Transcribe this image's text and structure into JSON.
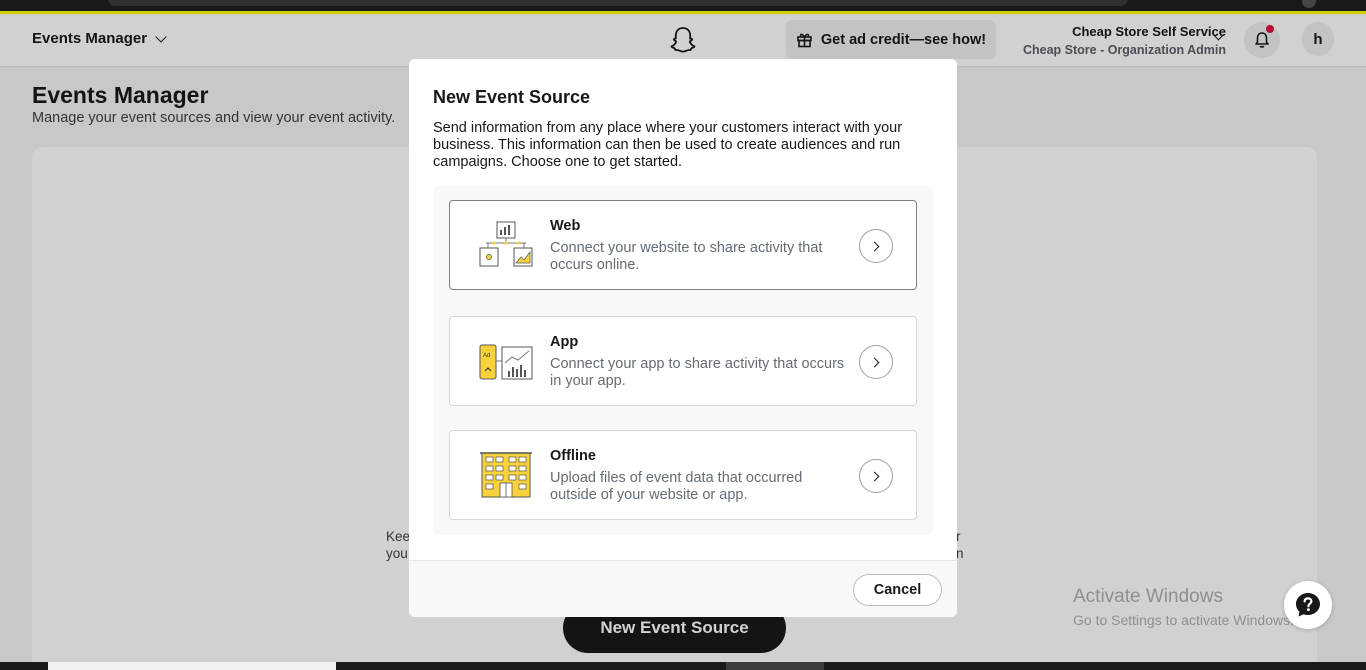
{
  "header": {
    "app_switcher_label": "Events Manager",
    "ad_credit_label": "Get ad credit—see how!",
    "account_name": "Cheap Store Self Service",
    "account_role": "Cheap Store - Organization Admin",
    "avatar_initial": "h"
  },
  "page": {
    "title": "Events Manager",
    "subtitle": "Manage your event sources and view your event activity.",
    "bg_text_left": [
      "Kee",
      "you"
    ],
    "bg_text_right": [
      "r",
      "n"
    ],
    "new_event_source_label": "New Event Source"
  },
  "modal": {
    "title": "New Event Source",
    "description": "Send information from any place where your customers interact with your business. This information can then be used to create audiences and run campaigns. Choose one to get started.",
    "options": [
      {
        "title": "Web",
        "description": "Connect your website to share activity that occurs online.",
        "icon": "web-icon",
        "selected": true
      },
      {
        "title": "App",
        "description": "Connect your app to share activity that occurs in your app.",
        "icon": "app-icon",
        "selected": false
      },
      {
        "title": "Offline",
        "description": "Upload files of event data that occurred outside of your website or app.",
        "icon": "offline-icon",
        "selected": false
      }
    ],
    "cancel_label": "Cancel"
  },
  "watermark": {
    "line1": "Activate Windows",
    "line2": "Go to Settings to activate Windows."
  },
  "colors": {
    "brand_yellow": "#fffc00",
    "illustration_yellow": "#f7d23c",
    "dark_button": "#16191c",
    "notification_dot": "#e1143d"
  }
}
